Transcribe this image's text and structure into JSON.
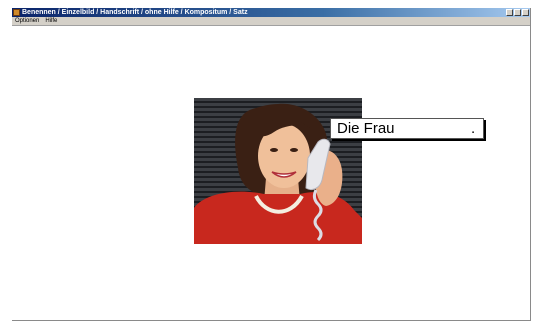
{
  "window": {
    "title": "Benennen / Einzelbild / Handschrift / ohne Hilfe / Kompositum / Satz"
  },
  "menu": {
    "items": [
      "Optionen",
      "Hilfe"
    ]
  },
  "exercise": {
    "answer_text": "Die Frau",
    "answer_end": "."
  },
  "icons": {
    "app": "app-icon",
    "minimize": "minimize-icon",
    "maximize": "maximize-icon",
    "close": "close-icon"
  },
  "colors": {
    "titlebar_start": "#0a246a",
    "titlebar_end": "#a6caf0",
    "sweater": "#c8281e"
  }
}
